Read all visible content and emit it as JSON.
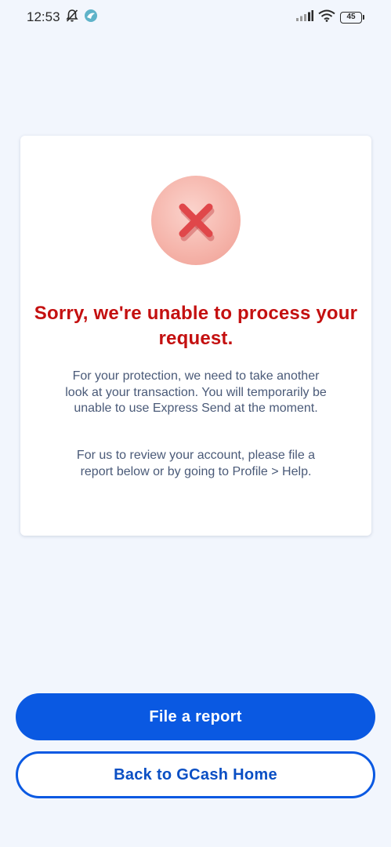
{
  "status_bar": {
    "time": "12:53",
    "battery_level": "45",
    "icons": [
      "bell-muted-icon",
      "app-notification-icon",
      "signal-icon",
      "wifi-icon",
      "battery-icon"
    ]
  },
  "error_card": {
    "icon": "close-x-icon",
    "title": "Sorry, we're unable to process your request.",
    "description": "For your protection, we need to take another look at your transaction. You will temporarily be unable to use Express Send at the moment.",
    "help_text": "For us to review your account, please file a report below or by going to Profile > Help."
  },
  "actions": {
    "primary_label": "File a report",
    "secondary_label": "Back to GCash Home"
  },
  "colors": {
    "background": "#f2f6fd",
    "title_red": "#c41010",
    "brand_blue": "#0a59e2",
    "body_text": "#4a5a78"
  }
}
